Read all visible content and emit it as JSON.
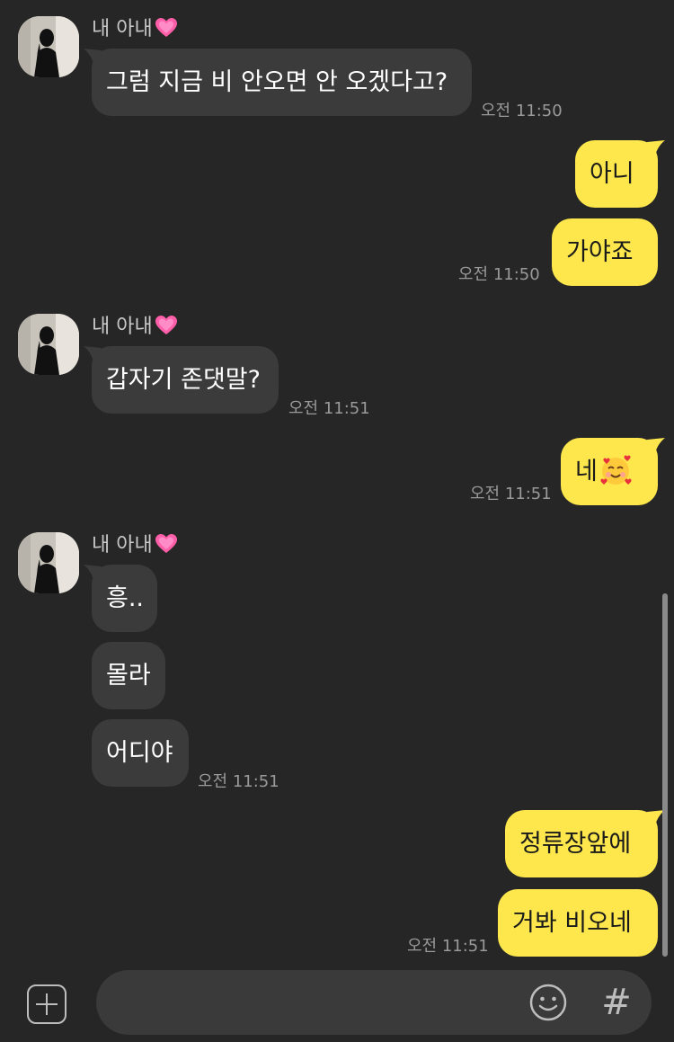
{
  "contact": {
    "name": "내 아내",
    "name_emoji_icon": "pink-heart-icon"
  },
  "messages": {
    "g1": {
      "text": "그럼 지금 비 안오면 안 오겠다고?",
      "time": "오전 11:50"
    },
    "g2": {
      "line1": "아니",
      "line2": "가야죠",
      "time": "오전 11:50"
    },
    "g3": {
      "text": "갑자기 존댓말?",
      "time": "오전 11:51"
    },
    "g4": {
      "text": "네",
      "emoji_icon": "smiling-face-with-hearts-icon",
      "time": "오전 11:51"
    },
    "g5": {
      "line1": "흥..",
      "line2": "몰라",
      "line3": "어디야",
      "time": "오전 11:51"
    },
    "g6": {
      "line1": "정류장앞에",
      "line2": "거봐 비오네",
      "time": "오전 11:51"
    }
  },
  "input": {
    "placeholder": "",
    "value": ""
  },
  "icons": {
    "add": "plus-square-icon",
    "emoji": "emoji-icon",
    "hashtag": "hash-icon"
  },
  "colors": {
    "background": "#262626",
    "incoming_bubble": "#3b3b3b",
    "outgoing_bubble": "#fde74c",
    "timestamp": "#9a9a9a"
  },
  "hash_symbol": "#"
}
